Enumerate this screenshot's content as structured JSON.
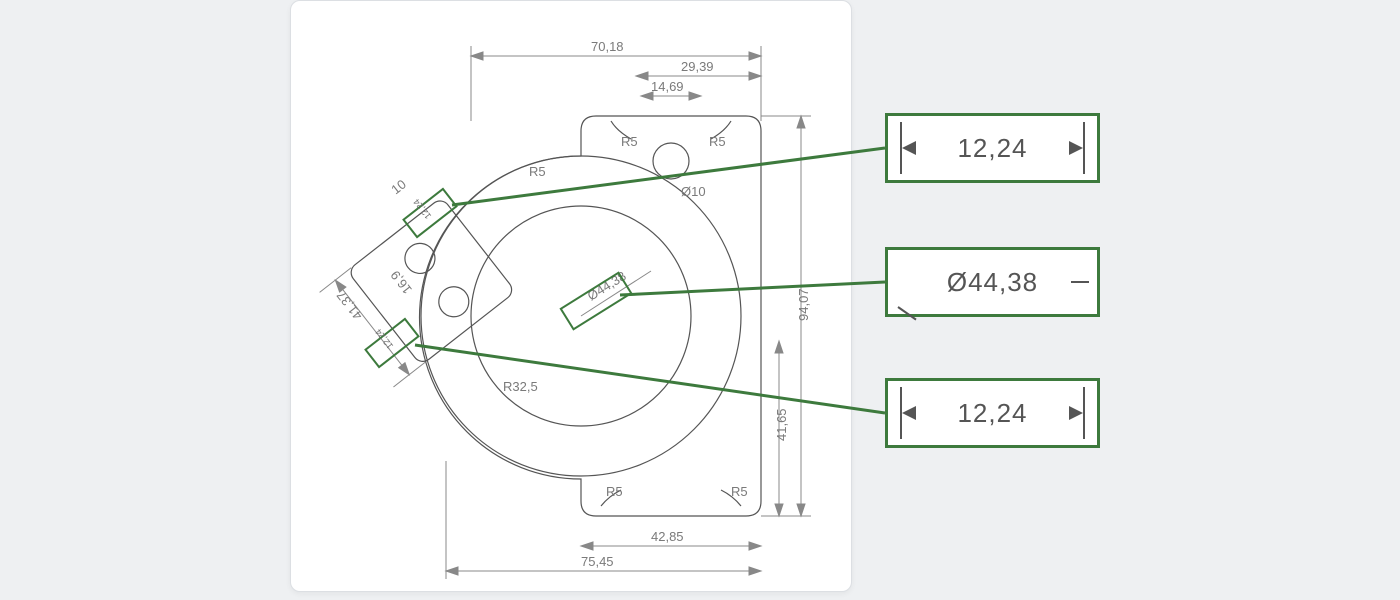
{
  "dimensions": {
    "top_overall": "70,18",
    "top_sub": "29,39",
    "top_inner": "14,69",
    "left_angled_outer": "41,37",
    "left_angled_mid": "16,9",
    "left_angled_small_a": "12,24",
    "left_angled_small_b": "12,24",
    "left_offset_10": "10",
    "right_overall_height": "94,07",
    "right_lower_height": "41,65",
    "bottom_inner": "42,85",
    "bottom_overall": "75,45",
    "dia_main": "Ø44,38",
    "dia_small": "Ø10",
    "r5_a": "R5",
    "r5_b": "R5",
    "r5_c": "R5",
    "r5_d": "R5",
    "r5_e": "R5",
    "r_inner": "R32,5"
  },
  "callouts": {
    "c1": "12,24",
    "c2": "Ø44,38",
    "c3": "12,24"
  },
  "colors": {
    "accent": "#3d7a3d",
    "line": "#6d6d6d"
  }
}
